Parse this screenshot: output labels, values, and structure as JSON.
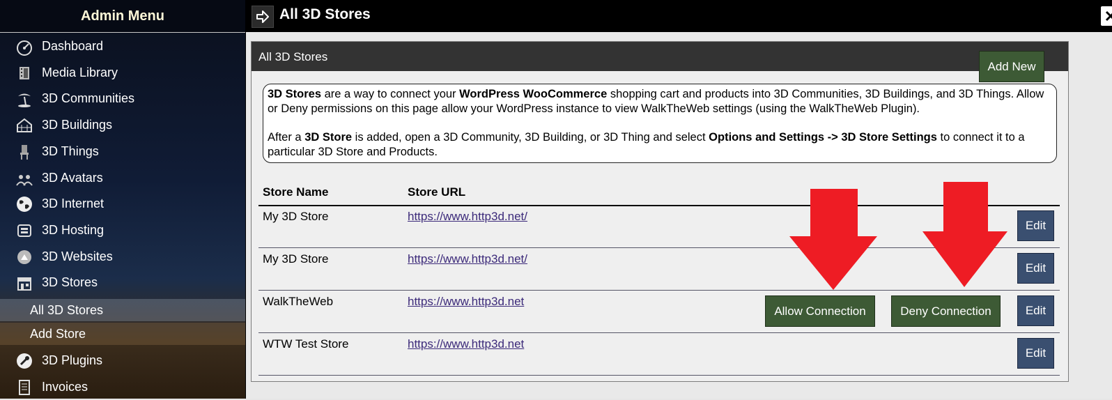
{
  "sidebar": {
    "title": "Admin Menu",
    "items": [
      {
        "label": "Dashboard",
        "icon": "dashboard-icon"
      },
      {
        "label": "Media Library",
        "icon": "film-icon"
      },
      {
        "label": "3D Communities",
        "icon": "palm-island-icon"
      },
      {
        "label": "3D Buildings",
        "icon": "building-icon"
      },
      {
        "label": "3D Things",
        "icon": "chair-icon"
      },
      {
        "label": "3D Avatars",
        "icon": "avatars-icon"
      },
      {
        "label": "3D Internet",
        "icon": "globe-icon"
      },
      {
        "label": "3D Hosting",
        "icon": "hosting-icon"
      },
      {
        "label": "3D Websites",
        "icon": "websites-icon"
      },
      {
        "label": "3D Stores",
        "icon": "store-icon"
      },
      {
        "label": "3D Plugins",
        "icon": "plugin-icon"
      },
      {
        "label": "Invoices",
        "icon": "invoice-icon"
      }
    ],
    "sub_items": [
      {
        "label": "All 3D Stores",
        "active": true
      },
      {
        "label": "Add Store",
        "active": false
      }
    ]
  },
  "topbar": {
    "title": "All 3D Stores",
    "close_label": "✕"
  },
  "panel": {
    "title": "All 3D Stores",
    "add_new": "Add New"
  },
  "info": {
    "p1_bold1": "3D Stores",
    "p1_text1": " are a way to connect your ",
    "p1_bold2": "WordPress WooCommerce",
    "p1_text2": " shopping cart and products into 3D Communities, 3D Buildings, and 3D Things. Allow or Deny permissions on this page allow your WordPress instance to view WalkTheWeb settings (using the WalkTheWeb Plugin).",
    "p2_text1": "After a ",
    "p2_bold1": "3D Store",
    "p2_text2": " is added, open a 3D Community, 3D Building, or 3D Thing and select ",
    "p2_bold2": "Options and Settings -> 3D Store Settings",
    "p2_text3": " to connect it to a particular 3D Store and Products."
  },
  "table": {
    "headers": [
      "Store Name",
      "Store URL"
    ],
    "rows": [
      {
        "name": "My 3D Store",
        "url": "https://www.http3d.net/",
        "edit": "Edit"
      },
      {
        "name": "My 3D Store",
        "url": "https://www.http3d.net/",
        "edit": "Edit"
      },
      {
        "name": "WalkTheWeb",
        "url": "https://www.http3d.net",
        "edit": "Edit",
        "allow": "Allow Connection",
        "deny": "Deny Connection"
      },
      {
        "name": "WTW Test Store",
        "url": "https://www.http3d.net",
        "edit": "Edit"
      }
    ]
  },
  "colors": {
    "arrow": "#ee1c24",
    "green_button": "#3d5a35",
    "blue_button": "#3a4f70"
  }
}
